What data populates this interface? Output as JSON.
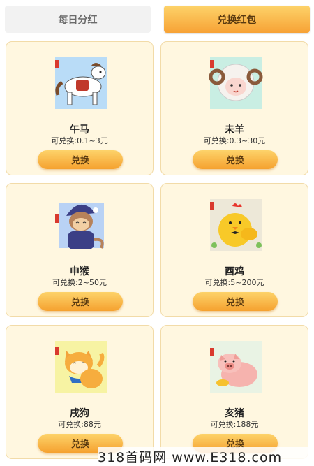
{
  "tabs": {
    "daily_dividend": "每日分红",
    "redeem_redpacket": "兑换红包"
  },
  "cards": [
    {
      "name": "午马",
      "price": "可兑换:0.1~3元",
      "button": "兑换",
      "icon": "horse-icon"
    },
    {
      "name": "未羊",
      "price": "可兑换:0.3~30元",
      "button": "兑换",
      "icon": "sheep-icon"
    },
    {
      "name": "申猴",
      "price": "可兑换:2~50元",
      "button": "兑换",
      "icon": "monkey-icon"
    },
    {
      "name": "酉鸡",
      "price": "可兑换:5~200元",
      "button": "兑换",
      "icon": "chicken-icon"
    },
    {
      "name": "戌狗",
      "price": "可兑换:88元",
      "button": "兑换",
      "icon": "dog-icon"
    },
    {
      "name": "亥猪",
      "price": "可兑换:188元",
      "button": "兑换",
      "icon": "pig-icon"
    }
  ],
  "watermark": "318首码网 www.E318.com"
}
